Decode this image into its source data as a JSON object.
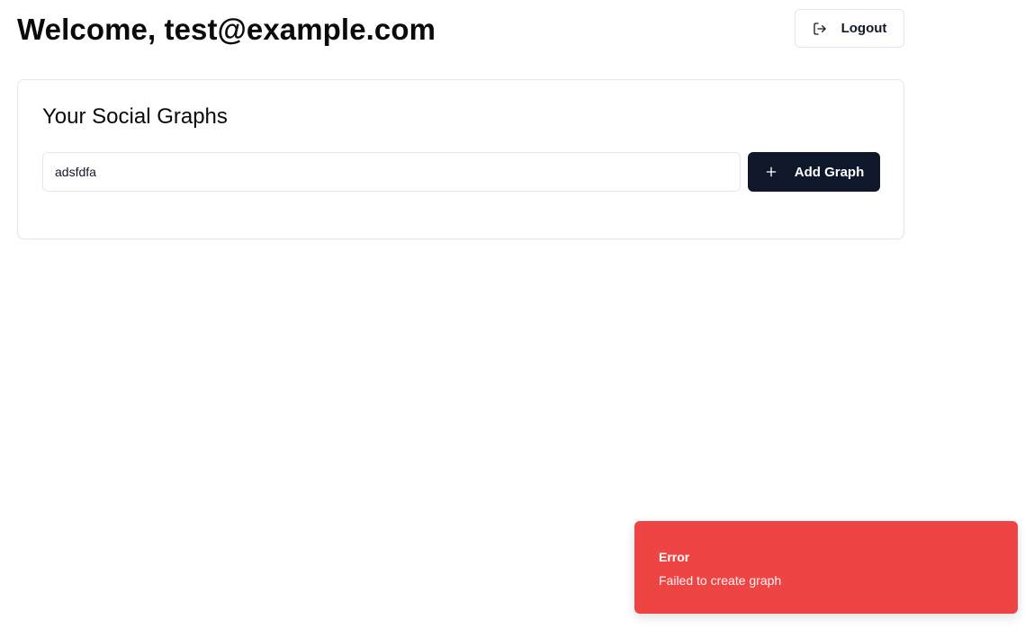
{
  "header": {
    "title": "Welcome, test@example.com",
    "logout_label": "Logout",
    "logout_icon": "log-out-icon"
  },
  "graphs_card": {
    "title": "Your Social Graphs",
    "input_value": "adsfdfa",
    "add_label": "Add Graph",
    "add_icon": "plus-icon"
  },
  "toast": {
    "title": "Error",
    "description": "Failed to create graph"
  },
  "colors": {
    "primary": "#0f172a",
    "destructive": "#ef4444",
    "border": "#e5e7eb"
  }
}
